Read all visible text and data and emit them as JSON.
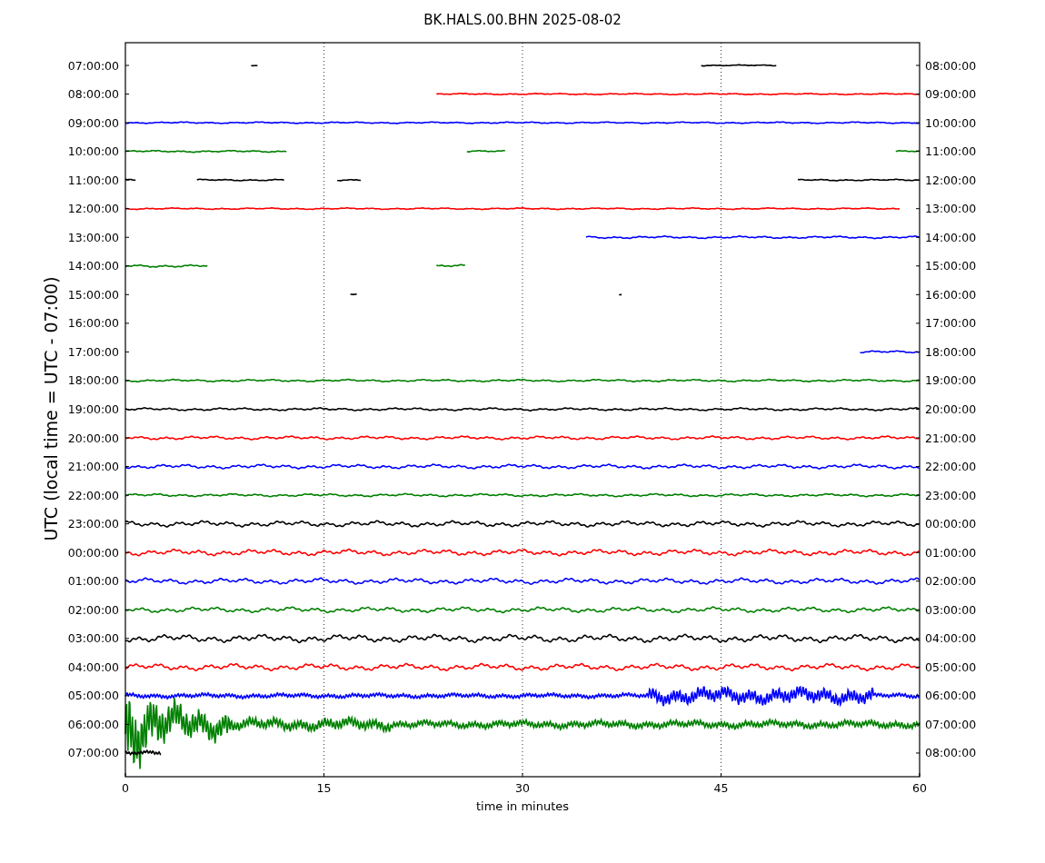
{
  "title": "BK.HALS.00.BHN 2025-08-02",
  "ylabel": "UTC (local time = UTC - 07:00)",
  "xlabel": "time in minutes",
  "xticks": [
    "0",
    "15",
    "30",
    "45",
    "60"
  ],
  "traces": [
    {
      "left_label": "07:00:00",
      "right_label": "08:00:00",
      "color": "#000000"
    },
    {
      "left_label": "08:00:00",
      "right_label": "09:00:00",
      "color": "#ff0000"
    },
    {
      "left_label": "09:00:00",
      "right_label": "10:00:00",
      "color": "#0000ff"
    },
    {
      "left_label": "10:00:00",
      "right_label": "11:00:00",
      "color": "#008000"
    },
    {
      "left_label": "11:00:00",
      "right_label": "12:00:00",
      "color": "#000000"
    },
    {
      "left_label": "12:00:00",
      "right_label": "13:00:00",
      "color": "#ff0000"
    },
    {
      "left_label": "13:00:00",
      "right_label": "14:00:00",
      "color": "#0000ff"
    },
    {
      "left_label": "14:00:00",
      "right_label": "15:00:00",
      "color": "#008000"
    },
    {
      "left_label": "15:00:00",
      "right_label": "16:00:00",
      "color": "#000000"
    },
    {
      "left_label": "16:00:00",
      "right_label": "17:00:00"
    },
    {
      "left_label": "17:00:00",
      "right_label": "18:00:00",
      "color": "#0000ff"
    },
    {
      "left_label": "18:00:00",
      "right_label": "19:00:00",
      "color": "#008000"
    },
    {
      "left_label": "19:00:00",
      "right_label": "20:00:00",
      "color": "#000000"
    },
    {
      "left_label": "20:00:00",
      "right_label": "21:00:00",
      "color": "#ff0000"
    },
    {
      "left_label": "21:00:00",
      "right_label": "22:00:00",
      "color": "#0000ff"
    },
    {
      "left_label": "22:00:00",
      "right_label": "23:00:00",
      "color": "#008000"
    },
    {
      "left_label": "23:00:00",
      "right_label": "00:00:00",
      "color": "#000000"
    },
    {
      "left_label": "00:00:00",
      "right_label": "01:00:00",
      "color": "#ff0000"
    },
    {
      "left_label": "01:00:00",
      "right_label": "02:00:00",
      "color": "#0000ff"
    },
    {
      "left_label": "02:00:00",
      "right_label": "03:00:00",
      "color": "#008000"
    },
    {
      "left_label": "03:00:00",
      "right_label": "04:00:00",
      "color": "#000000"
    },
    {
      "left_label": "04:00:00",
      "right_label": "05:00:00",
      "color": "#ff0000"
    },
    {
      "left_label": "05:00:00",
      "right_label": "06:00:00",
      "color": "#0000ff"
    },
    {
      "left_label": "06:00:00",
      "right_label": "07:00:00",
      "color": "#008000"
    },
    {
      "left_label": "07:00:00",
      "right_label": "08:00:00",
      "color": "#000000"
    }
  ]
}
